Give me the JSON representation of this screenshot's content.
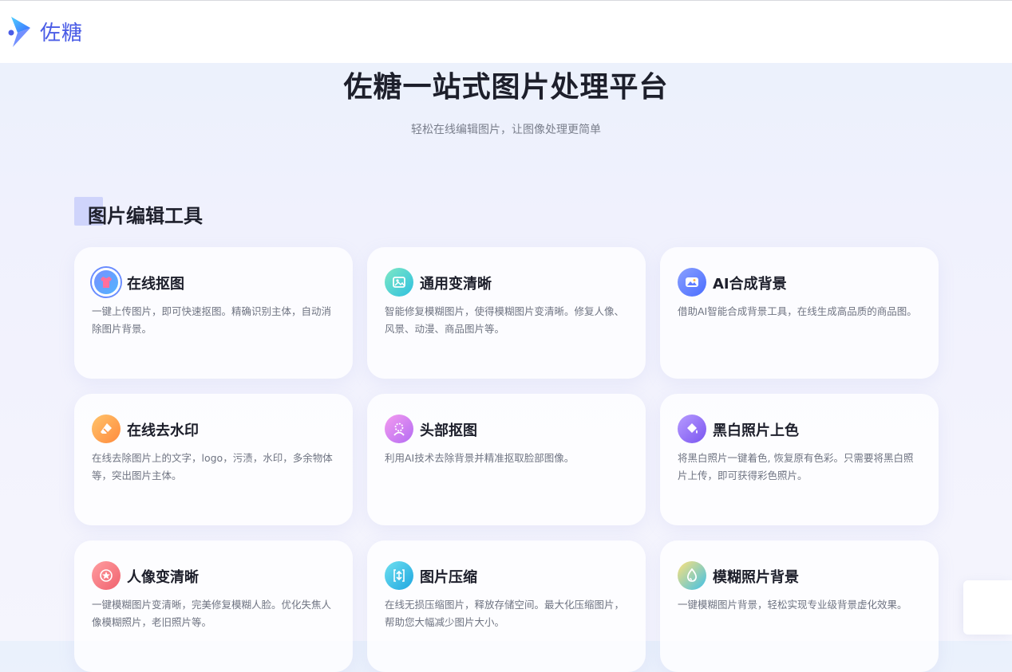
{
  "header": {
    "logo_text": "佐糖"
  },
  "hero": {
    "title": "佐糖一站式图片处理平台",
    "subtitle": "轻松在线编辑图片，让图像处理更简单"
  },
  "section": {
    "title": "图片编辑工具"
  },
  "cards": [
    {
      "title": "在线抠图",
      "desc": "一键上传图片，即可快速抠图。精确识别主体，自动消除图片背景。",
      "icon": "tshirt-icon",
      "color_from": "#7b8cff",
      "color_to": "#4fb8ff"
    },
    {
      "title": "通用变清晰",
      "desc": "智能修复模糊图片，使得模糊图片变清晰。修复人像、风景、动漫、商品图片等。",
      "icon": "image-enhance-icon",
      "color_from": "#7ee8c4",
      "color_to": "#2ec0e0"
    },
    {
      "title": "AI合成背景",
      "desc": "借助AI智能合成背景工具，在线生成高品质的商品图。",
      "icon": "landscape-icon",
      "color_from": "#8aa0ff",
      "color_to": "#4a6dff"
    },
    {
      "title": "在线去水印",
      "desc": "在线去除图片上的文字，logo，污渍，水印，多余物体等，突出图片主体。",
      "icon": "eraser-icon",
      "color_from": "#ffc46b",
      "color_to": "#ff8a3d"
    },
    {
      "title": "头部抠图",
      "desc": "利用AI技术去除背景并精准抠取脸部图像。",
      "icon": "head-cutout-icon",
      "color_from": "#f49bf0",
      "color_to": "#b46cf2"
    },
    {
      "title": "黑白照片上色",
      "desc": "将黑白照片一键着色, 恢复原有色彩。只需要将黑白照片上传，即可获得彩色照片。",
      "icon": "paint-bucket-icon",
      "color_from": "#b79bff",
      "color_to": "#7a55f0"
    },
    {
      "title": "人像变清晰",
      "desc": "一键模糊图片变清晰，完美修复模糊人脸。优化失焦人像模糊照片，老旧照片等。",
      "icon": "portrait-icon",
      "color_from": "#ff9ea0",
      "color_to": "#f0616e"
    },
    {
      "title": "图片压缩",
      "desc": "在线无损压缩图片，释放存储空间。最大化压缩图片，帮助您大幅减少图片大小。",
      "icon": "compress-icon",
      "color_from": "#6fe0f0",
      "color_to": "#1ea6e0"
    },
    {
      "title": "模糊照片背景",
      "desc": "一键模糊图片背景，轻松实现专业级背景虚化效果。",
      "icon": "droplet-icon",
      "color_from": "#ffe17a",
      "color_to": "#3fc0e8"
    }
  ]
}
